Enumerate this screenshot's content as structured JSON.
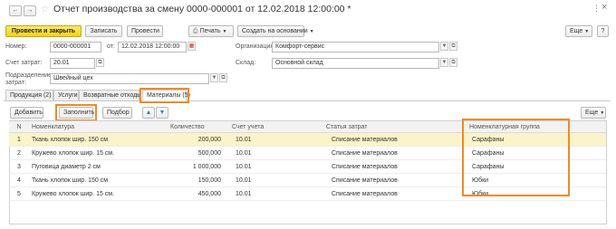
{
  "window": {
    "title": "Отчет производства за смену 0000-000001 от 12.02.2018 12:00:00 *",
    "more_icon": "⋮",
    "close_icon": "×"
  },
  "toolbar": {
    "post_close": "Провести и закрыть",
    "save": "Записать",
    "post": "Провести",
    "print": "Печать",
    "create_based": "Создать на основании",
    "more": "Еще",
    "help": "?"
  },
  "form": {
    "number_label": "Номер:",
    "number_value": "0000-000001",
    "date_label": "от:",
    "date_value": "12.02.2018 12:00:00",
    "account_label": "Счет затрат:",
    "account_value": "20.01",
    "division_label_1": "Подразделение",
    "division_label_2": "затрат:",
    "division_value": "Швейный цех",
    "org_label": "Организация:",
    "org_value": "Комфорт-сервис",
    "warehouse_label": "Склад:",
    "warehouse_value": "Основной склад"
  },
  "tabs": [
    {
      "label": "Продукция (2)"
    },
    {
      "label": "Услуги"
    },
    {
      "label": "Возвратные отходы"
    },
    {
      "label": "Материалы (5)"
    }
  ],
  "table_toolbar": {
    "add": "Добавить",
    "fill": "Заполнить",
    "pick": "Подбор",
    "more": "Еще"
  },
  "table": {
    "headers": [
      "N",
      "Номенклатура",
      "Количество",
      "Счет учета",
      "Статья затрат",
      "Номенклатурная группа"
    ],
    "rows": [
      [
        "1",
        "Ткань хлопок шир. 150 см",
        "200,000",
        "10.01",
        "Списание материалов",
        "Сарафаны"
      ],
      [
        "2",
        "Кружево хлопок шир. 15 см.",
        "500,000",
        "10.01",
        "Списание материалов",
        "Сарафаны"
      ],
      [
        "3",
        "Пуговица диаметр 2 см",
        "1 000,000",
        "10.01",
        "Списание материалов",
        "Сарафаны"
      ],
      [
        "4",
        "Ткань хлопок шир. 150 см",
        "150,000",
        "10.01",
        "Списание материалов",
        "Юбки"
      ],
      [
        "5",
        "Кружево хлопок шир. 15 см.",
        "450,000",
        "10.01",
        "Списание материалов",
        "Юбки"
      ]
    ],
    "selected_row": 0
  },
  "colors": {
    "highlight": "#f08a24",
    "primary_button": "#f4d21c",
    "selected_row": "#fbf3c9"
  }
}
